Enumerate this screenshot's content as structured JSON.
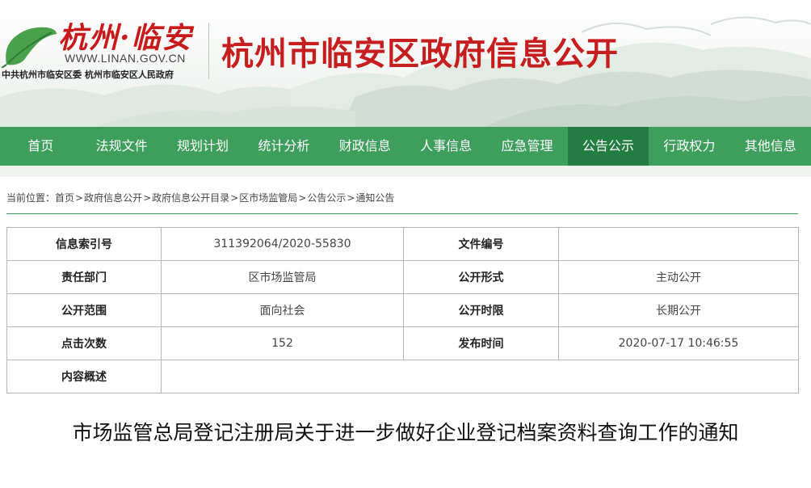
{
  "header": {
    "logo_title": "杭州·临安",
    "logo_url": "WWW.LINAN.GOV.CN",
    "logo_sub": "中共杭州市临安区委  杭州市临安区人民政府",
    "site_title": "杭州市临安区政府信息公开"
  },
  "nav": {
    "items": [
      {
        "label": "首页"
      },
      {
        "label": "法规文件"
      },
      {
        "label": "规划计划"
      },
      {
        "label": "统计分析"
      },
      {
        "label": "财政信息"
      },
      {
        "label": "人事信息"
      },
      {
        "label": "应急管理"
      },
      {
        "label": "公告公示"
      },
      {
        "label": "行政权力"
      },
      {
        "label": "其他信息"
      }
    ],
    "active_index": 7
  },
  "breadcrumb": {
    "prefix": "当前位置：",
    "items": [
      "首页",
      "政府信息公开",
      "政府信息公开目录",
      "区市场监管局",
      "公告公示",
      "通知公告"
    ],
    "separator": ">"
  },
  "info_table": {
    "rows": [
      [
        {
          "key": "信息索引号",
          "value": "311392064/2020-55830"
        },
        {
          "key": "文件编号",
          "value": ""
        }
      ],
      [
        {
          "key": "责任部门",
          "value": "区市场监管局"
        },
        {
          "key": "公开形式",
          "value": "主动公开"
        }
      ],
      [
        {
          "key": "公开范围",
          "value": "面向社会"
        },
        {
          "key": "公开时限",
          "value": "长期公开"
        }
      ],
      [
        {
          "key": "点击次数",
          "value": "152"
        },
        {
          "key": "发布时间",
          "value": "2020-07-17 10:46:55"
        }
      ],
      [
        {
          "key": "内容概述",
          "value": ""
        }
      ]
    ]
  },
  "article": {
    "title": "市场监管总局登记注册局关于进一步做好企业登记档案资料查询工作的通知"
  },
  "colors": {
    "nav_bg": "#3e9f5c",
    "nav_active": "#237c42",
    "title_red": "#c61e1e"
  }
}
